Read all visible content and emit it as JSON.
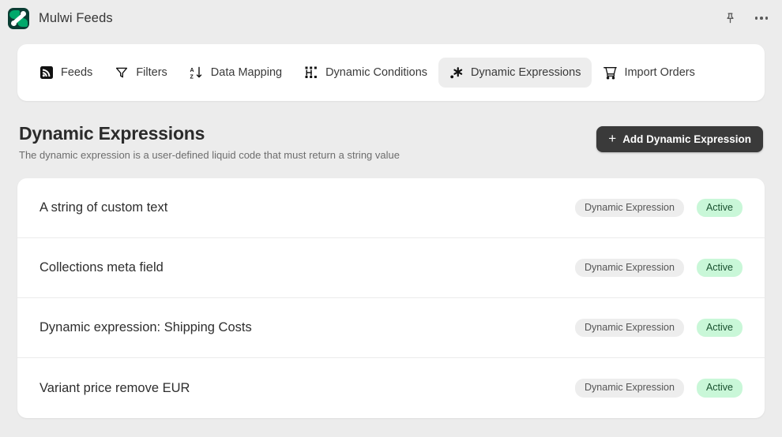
{
  "appbar": {
    "brand_title": "Mulwi Feeds",
    "logo_icon": "mulwi-logo-icon",
    "pin_icon": "pin-icon",
    "more_icon": "more-options-icon"
  },
  "tabs": [
    {
      "label": "Feeds",
      "icon": "rss-feed-icon",
      "active": false
    },
    {
      "label": "Filters",
      "icon": "filter-funnel-icon",
      "active": false
    },
    {
      "label": "Data Mapping",
      "icon": "sort-az-icon",
      "active": false
    },
    {
      "label": "Dynamic Conditions",
      "icon": "circuit-grid-icon",
      "active": false
    },
    {
      "label": "Dynamic Expressions",
      "icon": "asterisk-sparkle-icon",
      "active": true
    },
    {
      "label": "Import Orders",
      "icon": "shopping-cart-icon",
      "active": false
    }
  ],
  "header": {
    "title": "Dynamic Expressions",
    "subtitle": "The dynamic expression is a user-defined liquid code that must return a string value",
    "add_button_label": "Add Dynamic Expression",
    "add_button_icon": "plus-icon"
  },
  "list": {
    "rows": [
      {
        "name": "A string of custom text",
        "type": "Dynamic Expression",
        "status": "Active"
      },
      {
        "name": "Collections meta field",
        "type": "Dynamic Expression",
        "status": "Active"
      },
      {
        "name": "Dynamic expression: Shipping Costs",
        "type": "Dynamic Expression",
        "status": "Active"
      },
      {
        "name": "Variant price remove EUR",
        "type": "Dynamic Expression",
        "status": "Active"
      }
    ]
  },
  "colors": {
    "page_background": "#ececec",
    "card_background": "#ffffff",
    "primary_button": "#3a3a3a",
    "status_badge_bg": "#c9f7d8",
    "status_badge_text": "#19512f",
    "type_badge_bg": "#ededed",
    "brand_green": "#00a96b"
  }
}
